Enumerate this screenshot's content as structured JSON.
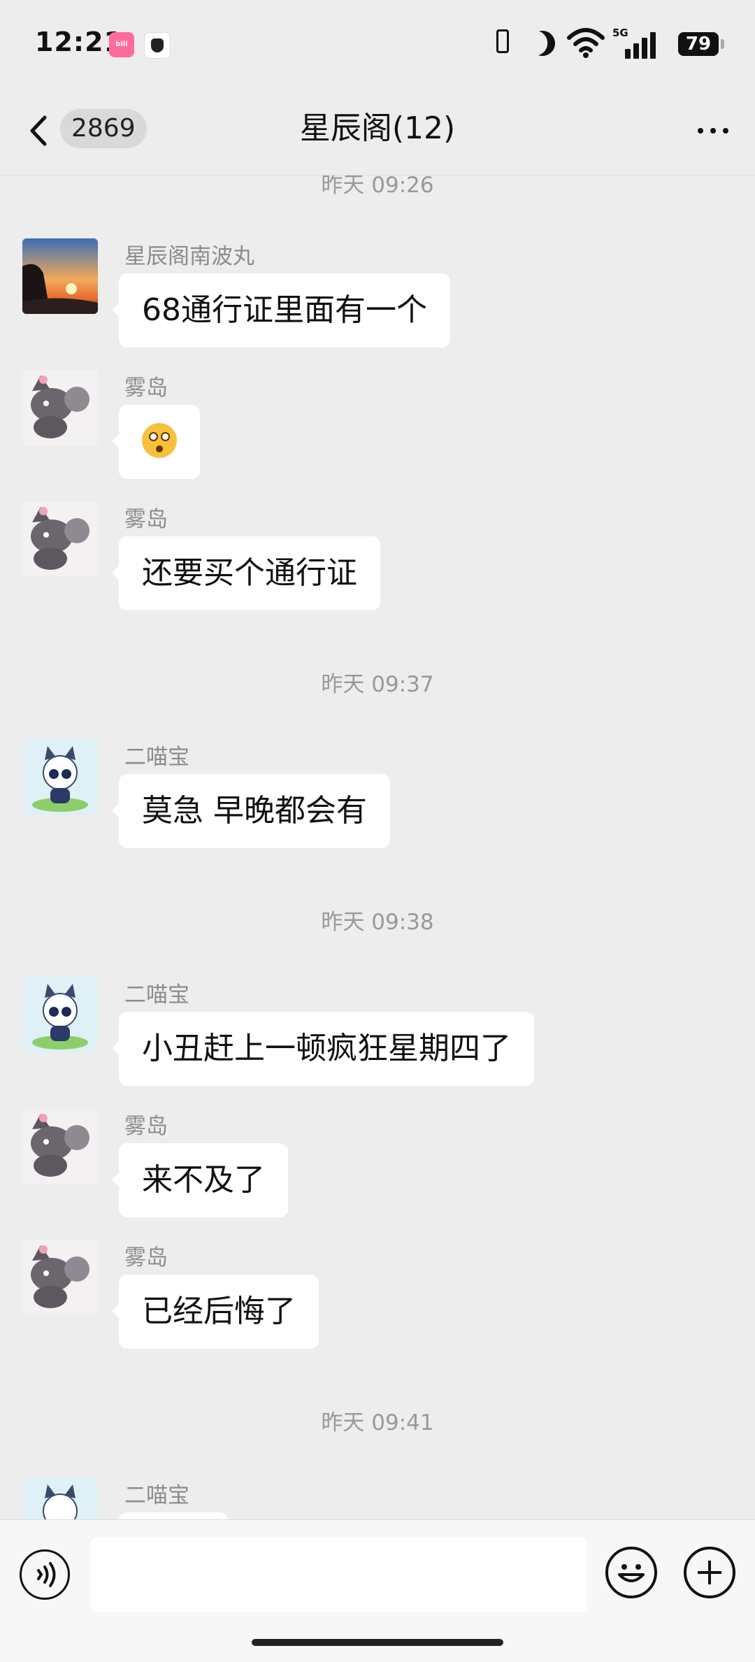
{
  "status_bar": {
    "time": "12:21",
    "app_icons": [
      "bilibili-icon",
      "app-icon"
    ],
    "network": "5G",
    "battery": "79"
  },
  "header": {
    "unread_count": "2869",
    "title": "星辰阁(12)"
  },
  "messages": [
    {
      "type": "timestamp",
      "text": "昨天 09:26"
    },
    {
      "type": "message",
      "sender": "星辰阁南波丸",
      "avatar": "sunset-avatar",
      "text": "68通行证里面有一个"
    },
    {
      "type": "message",
      "sender": "雾岛",
      "avatar": "gray-cat-avatar",
      "text": "",
      "emoji": "flushed-face-emoji"
    },
    {
      "type": "message",
      "sender": "雾岛",
      "avatar": "gray-cat-avatar",
      "text": "还要买个通行证"
    },
    {
      "type": "timestamp",
      "text": "昨天 09:37"
    },
    {
      "type": "message",
      "sender": "二喵宝",
      "avatar": "anime-cat-avatar",
      "text": "莫急 早晚都会有"
    },
    {
      "type": "timestamp",
      "text": "昨天 09:38"
    },
    {
      "type": "message",
      "sender": "二喵宝",
      "avatar": "anime-cat-avatar",
      "text": "小丑赶上一顿疯狂星期四了"
    },
    {
      "type": "message",
      "sender": "雾岛",
      "avatar": "gray-cat-avatar",
      "text": "来不及了"
    },
    {
      "type": "message",
      "sender": "雾岛",
      "avatar": "gray-cat-avatar",
      "text": "已经后悔了"
    },
    {
      "type": "timestamp",
      "text": "昨天 09:41"
    },
    {
      "type": "message",
      "sender": "二喵宝",
      "avatar": "anime-cat-avatar",
      "text": ""
    }
  ],
  "input": {
    "value": "",
    "placeholder": ""
  },
  "colors": {
    "background": "#ededed",
    "bubble": "#ffffff",
    "meta_text": "#999999"
  }
}
